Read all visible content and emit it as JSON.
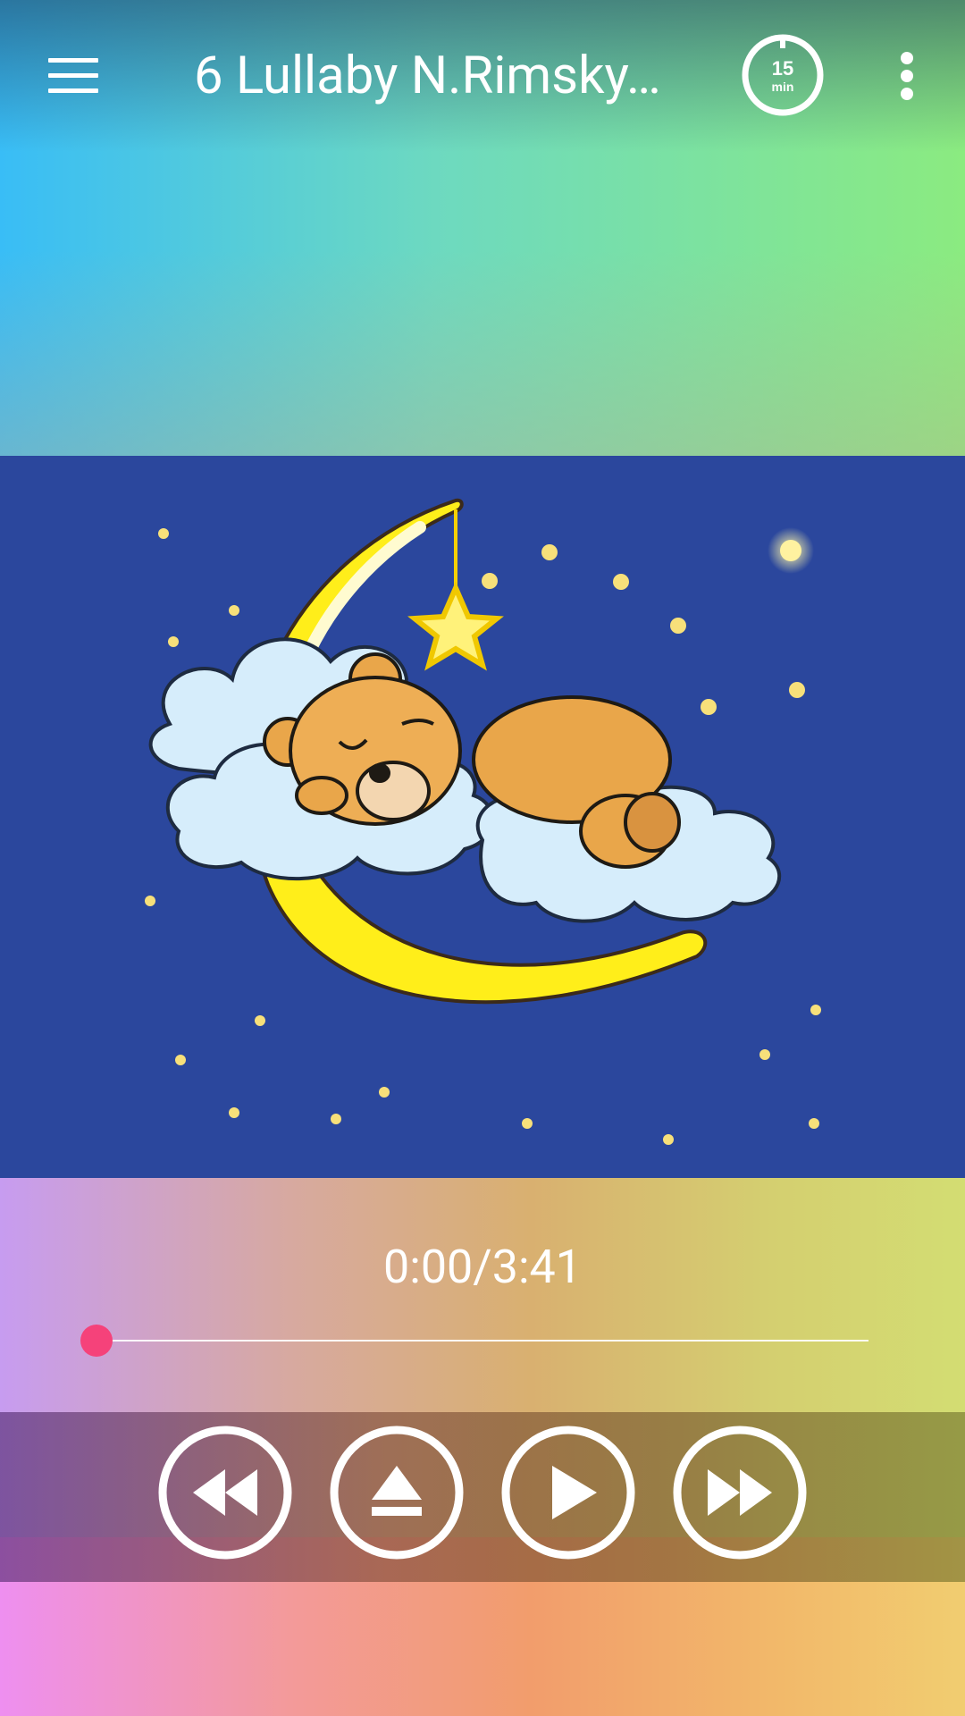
{
  "app_bar": {
    "title": "6 Lullaby N.Rimsky…",
    "timer_label_top": "15",
    "timer_label_bottom": "min"
  },
  "player": {
    "time_display": "0:00/3:41",
    "progress_fraction": 0.0
  },
  "controls": [
    "rewind-icon",
    "eject-icon",
    "play-icon",
    "fast-forward-icon"
  ],
  "artwork": {
    "description_icon": "sleeping-bear-on-moon-illustration"
  },
  "colors": {
    "seek_thumb": "#f5427a",
    "artwork_bg": "#2b479d",
    "moon": "#ffee1a",
    "bear": "#e9a64a"
  }
}
